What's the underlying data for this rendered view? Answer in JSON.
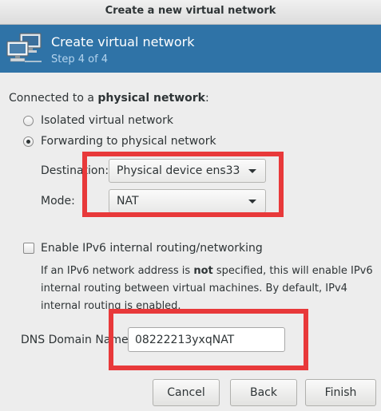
{
  "window": {
    "title": "Create a new virtual network"
  },
  "banner": {
    "title": "Create virtual network",
    "step": "Step 4 of 4",
    "icon": "network-computers-icon"
  },
  "connection": {
    "label_prefix": "Connected to a ",
    "label_bold": "physical network",
    "label_suffix": ":",
    "options": [
      {
        "label": "Isolated virtual network",
        "selected": false
      },
      {
        "label": "Forwarding to physical network",
        "selected": true
      }
    ]
  },
  "destination": {
    "label": "Destination:",
    "value": "Physical device ens33"
  },
  "mode": {
    "label": "Mode:",
    "value": "NAT"
  },
  "ipv6": {
    "label": "Enable IPv6 internal routing/networking",
    "checked": false,
    "desc_part1": "If an IPv6 network address is ",
    "desc_bold": "not",
    "desc_part2": " specified, this will enable IPv6 internal routing between virtual machines.  By default, IPv4 internal routing is enabled."
  },
  "dns": {
    "label": "DNS Domain Name:",
    "value": "08222213yxqNAT"
  },
  "buttons": {
    "cancel": "Cancel",
    "back": "Back",
    "finish": "Finish"
  },
  "colors": {
    "banner": "#2f73a7",
    "highlight": "#e8393a"
  }
}
